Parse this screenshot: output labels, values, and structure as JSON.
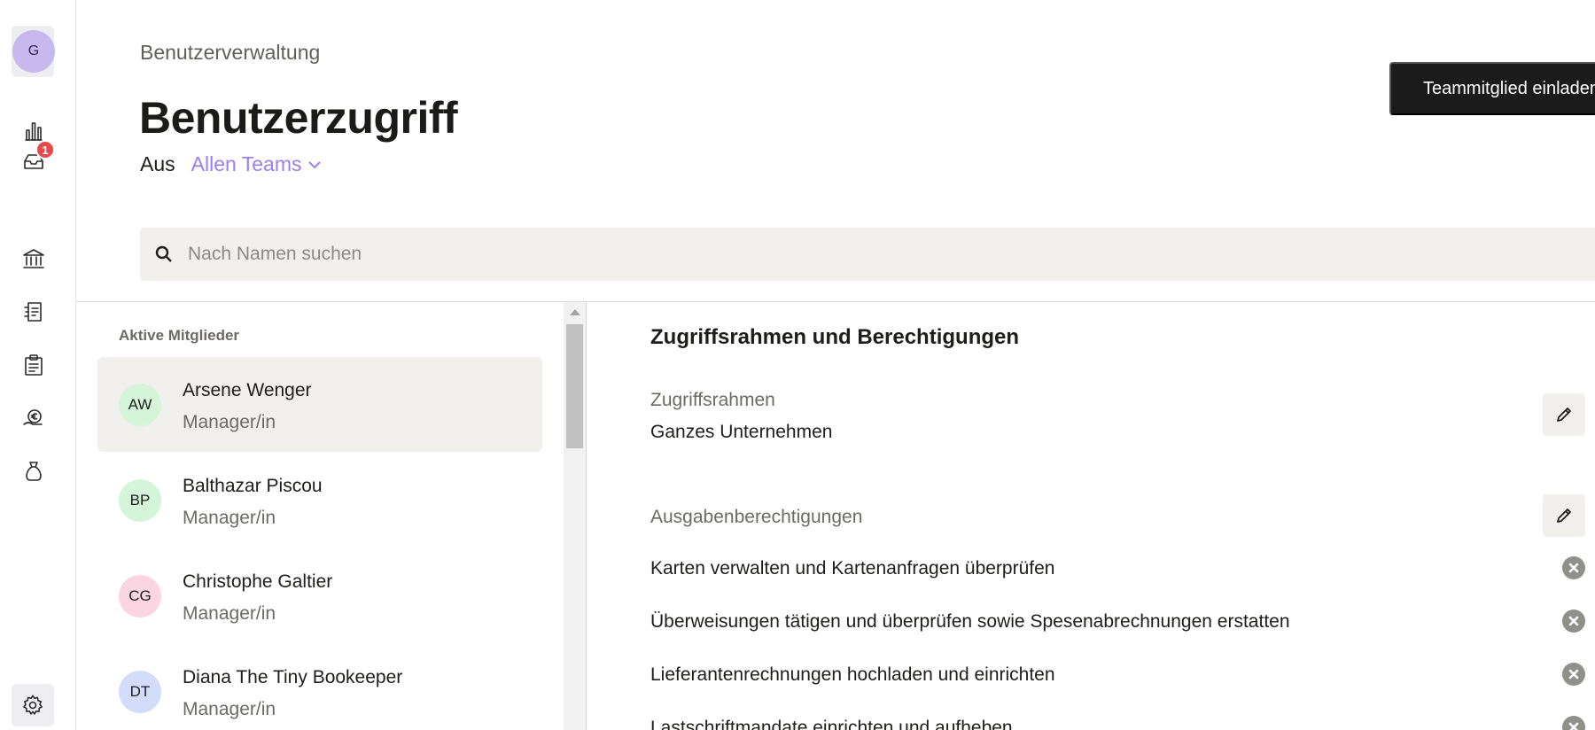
{
  "rail": {
    "avatar_initial": "G",
    "inbox_badge": "1",
    "icons": [
      "bar-chart-icon",
      "inbox-icon",
      "bank-icon",
      "receipt-icon",
      "clipboard-icon",
      "euro-hand-icon",
      "money-bag-icon",
      "gear-icon"
    ]
  },
  "header": {
    "breadcrumb": "Benutzerverwaltung",
    "title": "Benutzerzugriff",
    "scope_prefix": "Aus",
    "scope_value": "Allen Teams",
    "invite_button": "Teammitglied einladen"
  },
  "search": {
    "placeholder": "Nach Namen suchen",
    "value": ""
  },
  "members": {
    "section_label": "Aktive Mitglieder",
    "items": [
      {
        "initials": "AW",
        "name": "Arsene Wenger",
        "role": "Manager/in",
        "avatar_color": "#d4f5d9"
      },
      {
        "initials": "BP",
        "name": "Balthazar Piscou",
        "role": "Manager/in",
        "avatar_color": "#d4f5d9"
      },
      {
        "initials": "CG",
        "name": "Christophe Galtier",
        "role": "Manager/in",
        "avatar_color": "#fbd5e2"
      },
      {
        "initials": "DT",
        "name": "Diana The Tiny Bookeeper",
        "role": "Manager/in",
        "avatar_color": "#d3ddfb"
      }
    ]
  },
  "detail": {
    "title": "Zugriffsrahmen und Berechtigungen",
    "scope_label": "Zugriffsrahmen",
    "scope_value": "Ganzes Unternehmen",
    "permissions_label": "Ausgabenberechtigungen",
    "permissions": [
      "Karten verwalten und Kartenanfragen überprüfen",
      "Überweisungen tätigen und überprüfen sowie Spesenabrechnungen erstatten",
      "Lieferantenrechnungen hochladen und einrichten",
      "Lastschriftmandate einrichten und aufheben"
    ]
  },
  "colors": {
    "accent": "#9b7ff0",
    "badge": "#e8484a",
    "button_dark": "#1b1b1b",
    "surface": "#f1f0ec"
  }
}
